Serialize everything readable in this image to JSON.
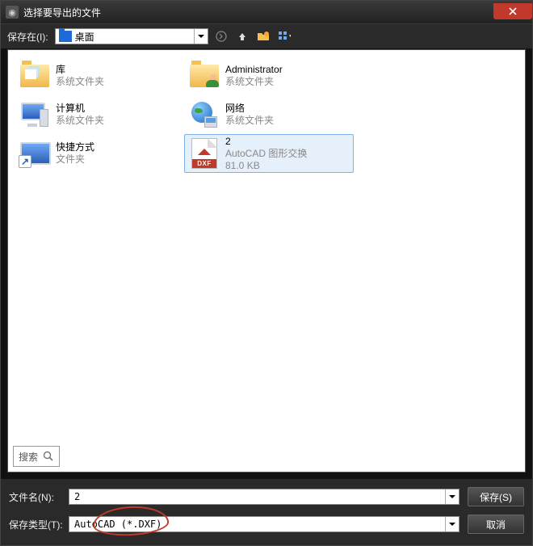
{
  "titlebar": {
    "title": "选择要导出的文件"
  },
  "toolbar": {
    "save_in_label": "保存在(I):",
    "location": "桌面"
  },
  "items": [
    {
      "name": "库",
      "sub": "系统文件夹"
    },
    {
      "name": "Administrator",
      "sub": "系统文件夹"
    },
    {
      "name": "计算机",
      "sub": "系统文件夹"
    },
    {
      "name": "网络",
      "sub": "系统文件夹"
    },
    {
      "name": "快捷方式",
      "sub": "文件夹"
    },
    {
      "name": "2",
      "sub": "AutoCAD 图形交换",
      "size": "81.0 KB"
    }
  ],
  "dxf_badge": "DXF",
  "search": {
    "label": "搜索"
  },
  "bottom": {
    "filename_label": "文件名(N):",
    "filename_value": "2",
    "filetype_label": "保存类型(T):",
    "filetype_value": "AutoCAD (*.DXF)",
    "save_btn": "保存(S)",
    "cancel_btn": "取消"
  }
}
